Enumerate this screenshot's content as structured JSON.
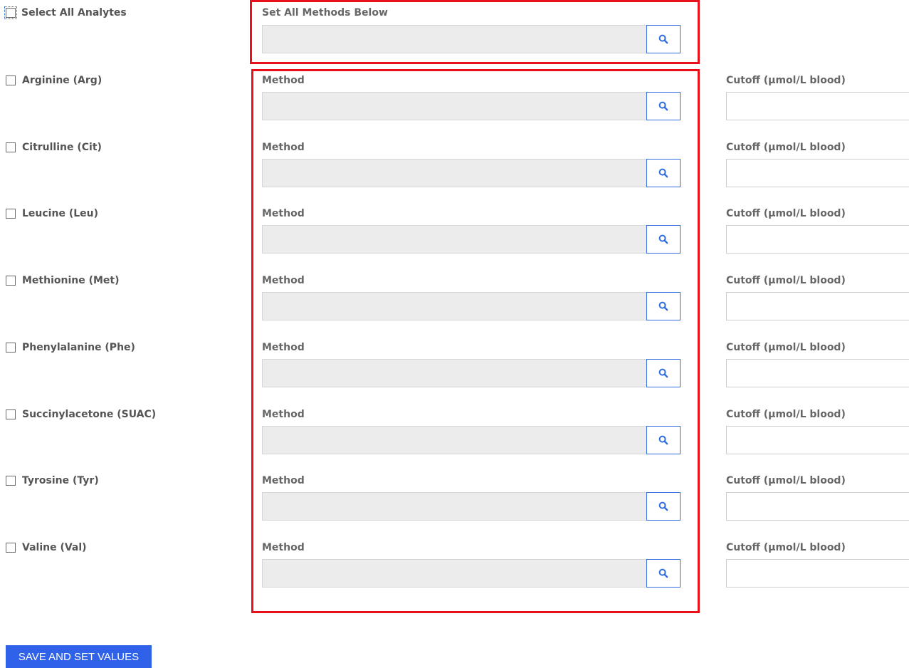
{
  "select_all": {
    "label": "Select All Analytes"
  },
  "set_all": {
    "label": "Set All Methods Below"
  },
  "analytes": [
    {
      "name": "Arginine (Arg)",
      "method_label": "Method",
      "cutoff_label": "Cutoff (µmol/L blood)",
      "method_value": "",
      "cutoff_value": ""
    },
    {
      "name": "Citrulline (Cit)",
      "method_label": "Method",
      "cutoff_label": "Cutoff (µmol/L blood)",
      "method_value": "",
      "cutoff_value": ""
    },
    {
      "name": "Leucine (Leu)",
      "method_label": "Method",
      "cutoff_label": "Cutoff (µmol/L blood)",
      "method_value": "",
      "cutoff_value": ""
    },
    {
      "name": "Methionine (Met)",
      "method_label": "Method",
      "cutoff_label": "Cutoff (µmol/L blood)",
      "method_value": "",
      "cutoff_value": ""
    },
    {
      "name": "Phenylalanine (Phe)",
      "method_label": "Method",
      "cutoff_label": "Cutoff (µmol/L blood)",
      "method_value": "",
      "cutoff_value": ""
    },
    {
      "name": "Succinylacetone (SUAC)",
      "method_label": "Method",
      "cutoff_label": "Cutoff (µmol/L blood)",
      "method_value": "",
      "cutoff_value": ""
    },
    {
      "name": "Tyrosine (Tyr)",
      "method_label": "Method",
      "cutoff_label": "Cutoff (µmol/L blood)",
      "method_value": "",
      "cutoff_value": ""
    },
    {
      "name": "Valine (Val)",
      "method_label": "Method",
      "cutoff_label": "Cutoff (µmol/L blood)",
      "method_value": "",
      "cutoff_value": ""
    }
  ],
  "icons": {
    "lookup": "search-icon",
    "checkbox": "checkbox-icon"
  },
  "colors": {
    "highlight": "#e8101a",
    "accent": "#2f62e8",
    "field_bg": "#ececec"
  },
  "save_button": {
    "label": "SAVE AND SET VALUES"
  }
}
